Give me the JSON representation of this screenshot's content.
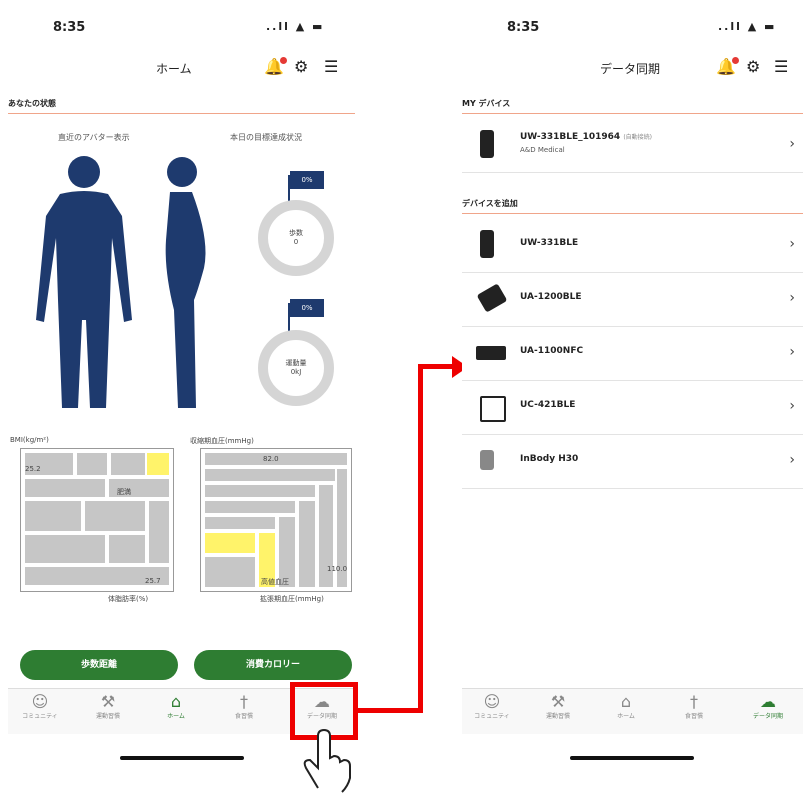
{
  "left_screen": {
    "status_time": "8:35",
    "status_icons": "..ll ▲ ▬",
    "title": "ホーム",
    "section_title": "あなたの状態",
    "col_left": "直近のアバター表示",
    "col_right": "本日の目標達成状況",
    "goal1": {
      "percent": "0%",
      "label": "歩数",
      "value": "0"
    },
    "goal2": {
      "percent": "0%",
      "label": "運動量",
      "value": "0kJ"
    },
    "chart_left": {
      "ylabel": "BMI(kg/m²)",
      "y_value": "25.2",
      "center_label": "肥満",
      "x_value": "25.7",
      "xlabel": "体脂肪率(%)"
    },
    "chart_right": {
      "ylabel": "収縮期血圧(mmHg)",
      "y_value": "82.0",
      "x_value": "110.0",
      "center_label": "高値血圧",
      "xlabel": "拡張期血圧(mmHg)"
    },
    "btn_steps": "歩数距離",
    "btn_calories": "消費カロリー",
    "tabs": [
      {
        "icon": "☺",
        "label": "コミュニティ"
      },
      {
        "icon": "⚒",
        "label": "運動習慣"
      },
      {
        "icon": "⌂",
        "label": "ホーム"
      },
      {
        "icon": "†",
        "label": "食習慣"
      },
      {
        "icon": "☁",
        "label": "データ同期"
      }
    ]
  },
  "right_screen": {
    "status_time": "8:35",
    "status_icons": "..ll ▲ ▬",
    "title": "データ同期",
    "my_devices_title": "MY デバイス",
    "my_device": {
      "name": "UW-331BLE_101964",
      "tag": "(自動接続)",
      "maker": "A&D Medical"
    },
    "add_title": "デバイスを追加",
    "devices": [
      "UW-331BLE",
      "UA-1200BLE",
      "UA-1100NFC",
      "UC-421BLE",
      "InBody H30"
    ],
    "tabs": [
      {
        "icon": "☺",
        "label": "コミュニティ"
      },
      {
        "icon": "⚒",
        "label": "運動習慣"
      },
      {
        "icon": "⌂",
        "label": "ホーム"
      },
      {
        "icon": "†",
        "label": "食習慣"
      },
      {
        "icon": "☁",
        "label": "データ同期"
      }
    ]
  },
  "colors": {
    "accent_green": "#2e7d32",
    "highlight_red": "#e00000",
    "navy": "#1e3a6e"
  }
}
